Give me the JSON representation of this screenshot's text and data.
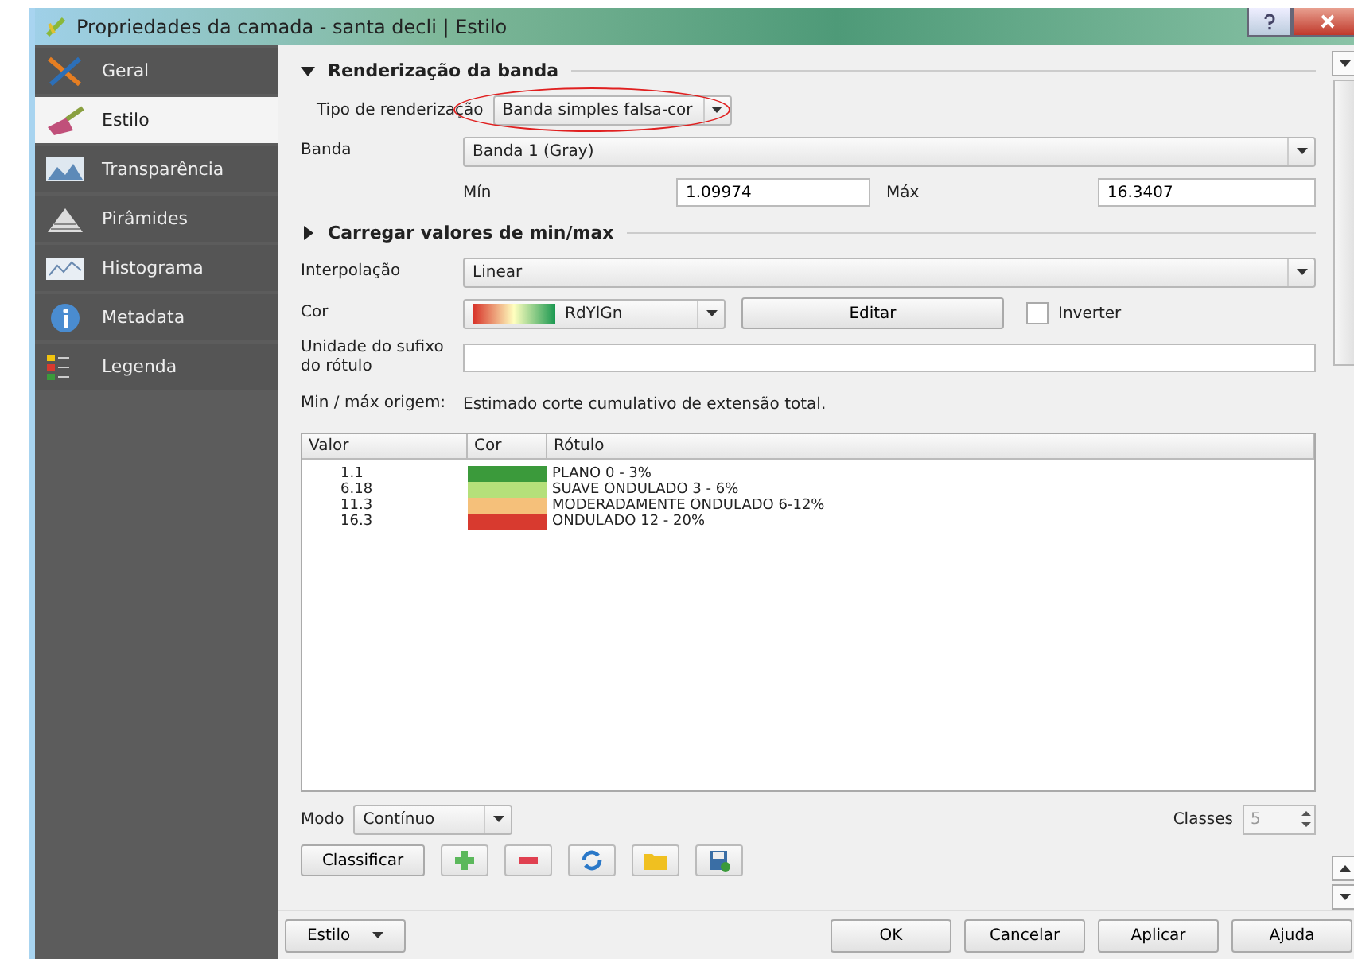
{
  "window": {
    "title": "Propriedades da camada - santa decli | Estilo"
  },
  "sidebar": {
    "items": [
      {
        "label": "Geral",
        "selected": false,
        "kind": "tools"
      },
      {
        "label": "Estilo",
        "selected": true,
        "kind": "brush"
      },
      {
        "label": "Transparência",
        "selected": false,
        "kind": "image"
      },
      {
        "label": "Pirâmides",
        "selected": false,
        "kind": "pyramid"
      },
      {
        "label": "Histograma",
        "selected": false,
        "kind": "chart"
      },
      {
        "label": "Metadata",
        "selected": false,
        "kind": "info"
      },
      {
        "label": "Legenda",
        "selected": false,
        "kind": "legend"
      }
    ]
  },
  "band_rendering": {
    "title": "Renderização da banda",
    "expanded": true,
    "render_type": {
      "label": "Tipo de renderização",
      "value": "Banda simples falsa-cor",
      "highlighted": true
    },
    "band": {
      "label": "Banda",
      "value": "Banda 1 (Gray)"
    },
    "min": {
      "label": "Mín",
      "value": "1.09974"
    },
    "max": {
      "label": "Máx",
      "value": "16.3407"
    }
  },
  "minmax_section": {
    "title": "Carregar valores de min/max",
    "expanded": false
  },
  "interpolation": {
    "label": "Interpolação",
    "value": "Linear"
  },
  "color": {
    "label": "Cor",
    "ramp": "RdYlGn",
    "edit_button": "Editar",
    "invert": {
      "label": "Inverter",
      "checked": false
    }
  },
  "suffix": {
    "label": "Unidade do sufixo do rótulo"
  },
  "origin": {
    "label": "Min / máx origem:",
    "text": "Estimado corte cumulativo de extensão total."
  },
  "table": {
    "columns": [
      "Valor",
      "Cor",
      "Rótulo"
    ],
    "rows": [
      {
        "value": "1.1",
        "color": "#3b9a3b",
        "label": "PLANO 0 - 3%"
      },
      {
        "value": "6.18",
        "color": "#b5e07a",
        "label": "SUAVE ONDULADO 3 - 6%"
      },
      {
        "value": "11.3",
        "color": "#f5c07a",
        "label": "MODERADAMENTE ONDULADO 6-12%"
      },
      {
        "value": "16.3",
        "color": "#d83a2f",
        "label": "ONDULADO 12 - 20%"
      }
    ]
  },
  "mode": {
    "label": "Modo",
    "value": "Contínuo"
  },
  "classes": {
    "label": "Classes",
    "value": "5",
    "disabled": true
  },
  "classify_button": "Classificar",
  "tool_buttons": [
    {
      "kind": "add"
    },
    {
      "kind": "remove"
    },
    {
      "kind": "refresh"
    },
    {
      "kind": "open"
    },
    {
      "kind": "save"
    }
  ],
  "footer": {
    "style_button": "Estilo",
    "buttons": [
      "OK",
      "Cancelar",
      "Aplicar",
      "Ajuda"
    ]
  }
}
